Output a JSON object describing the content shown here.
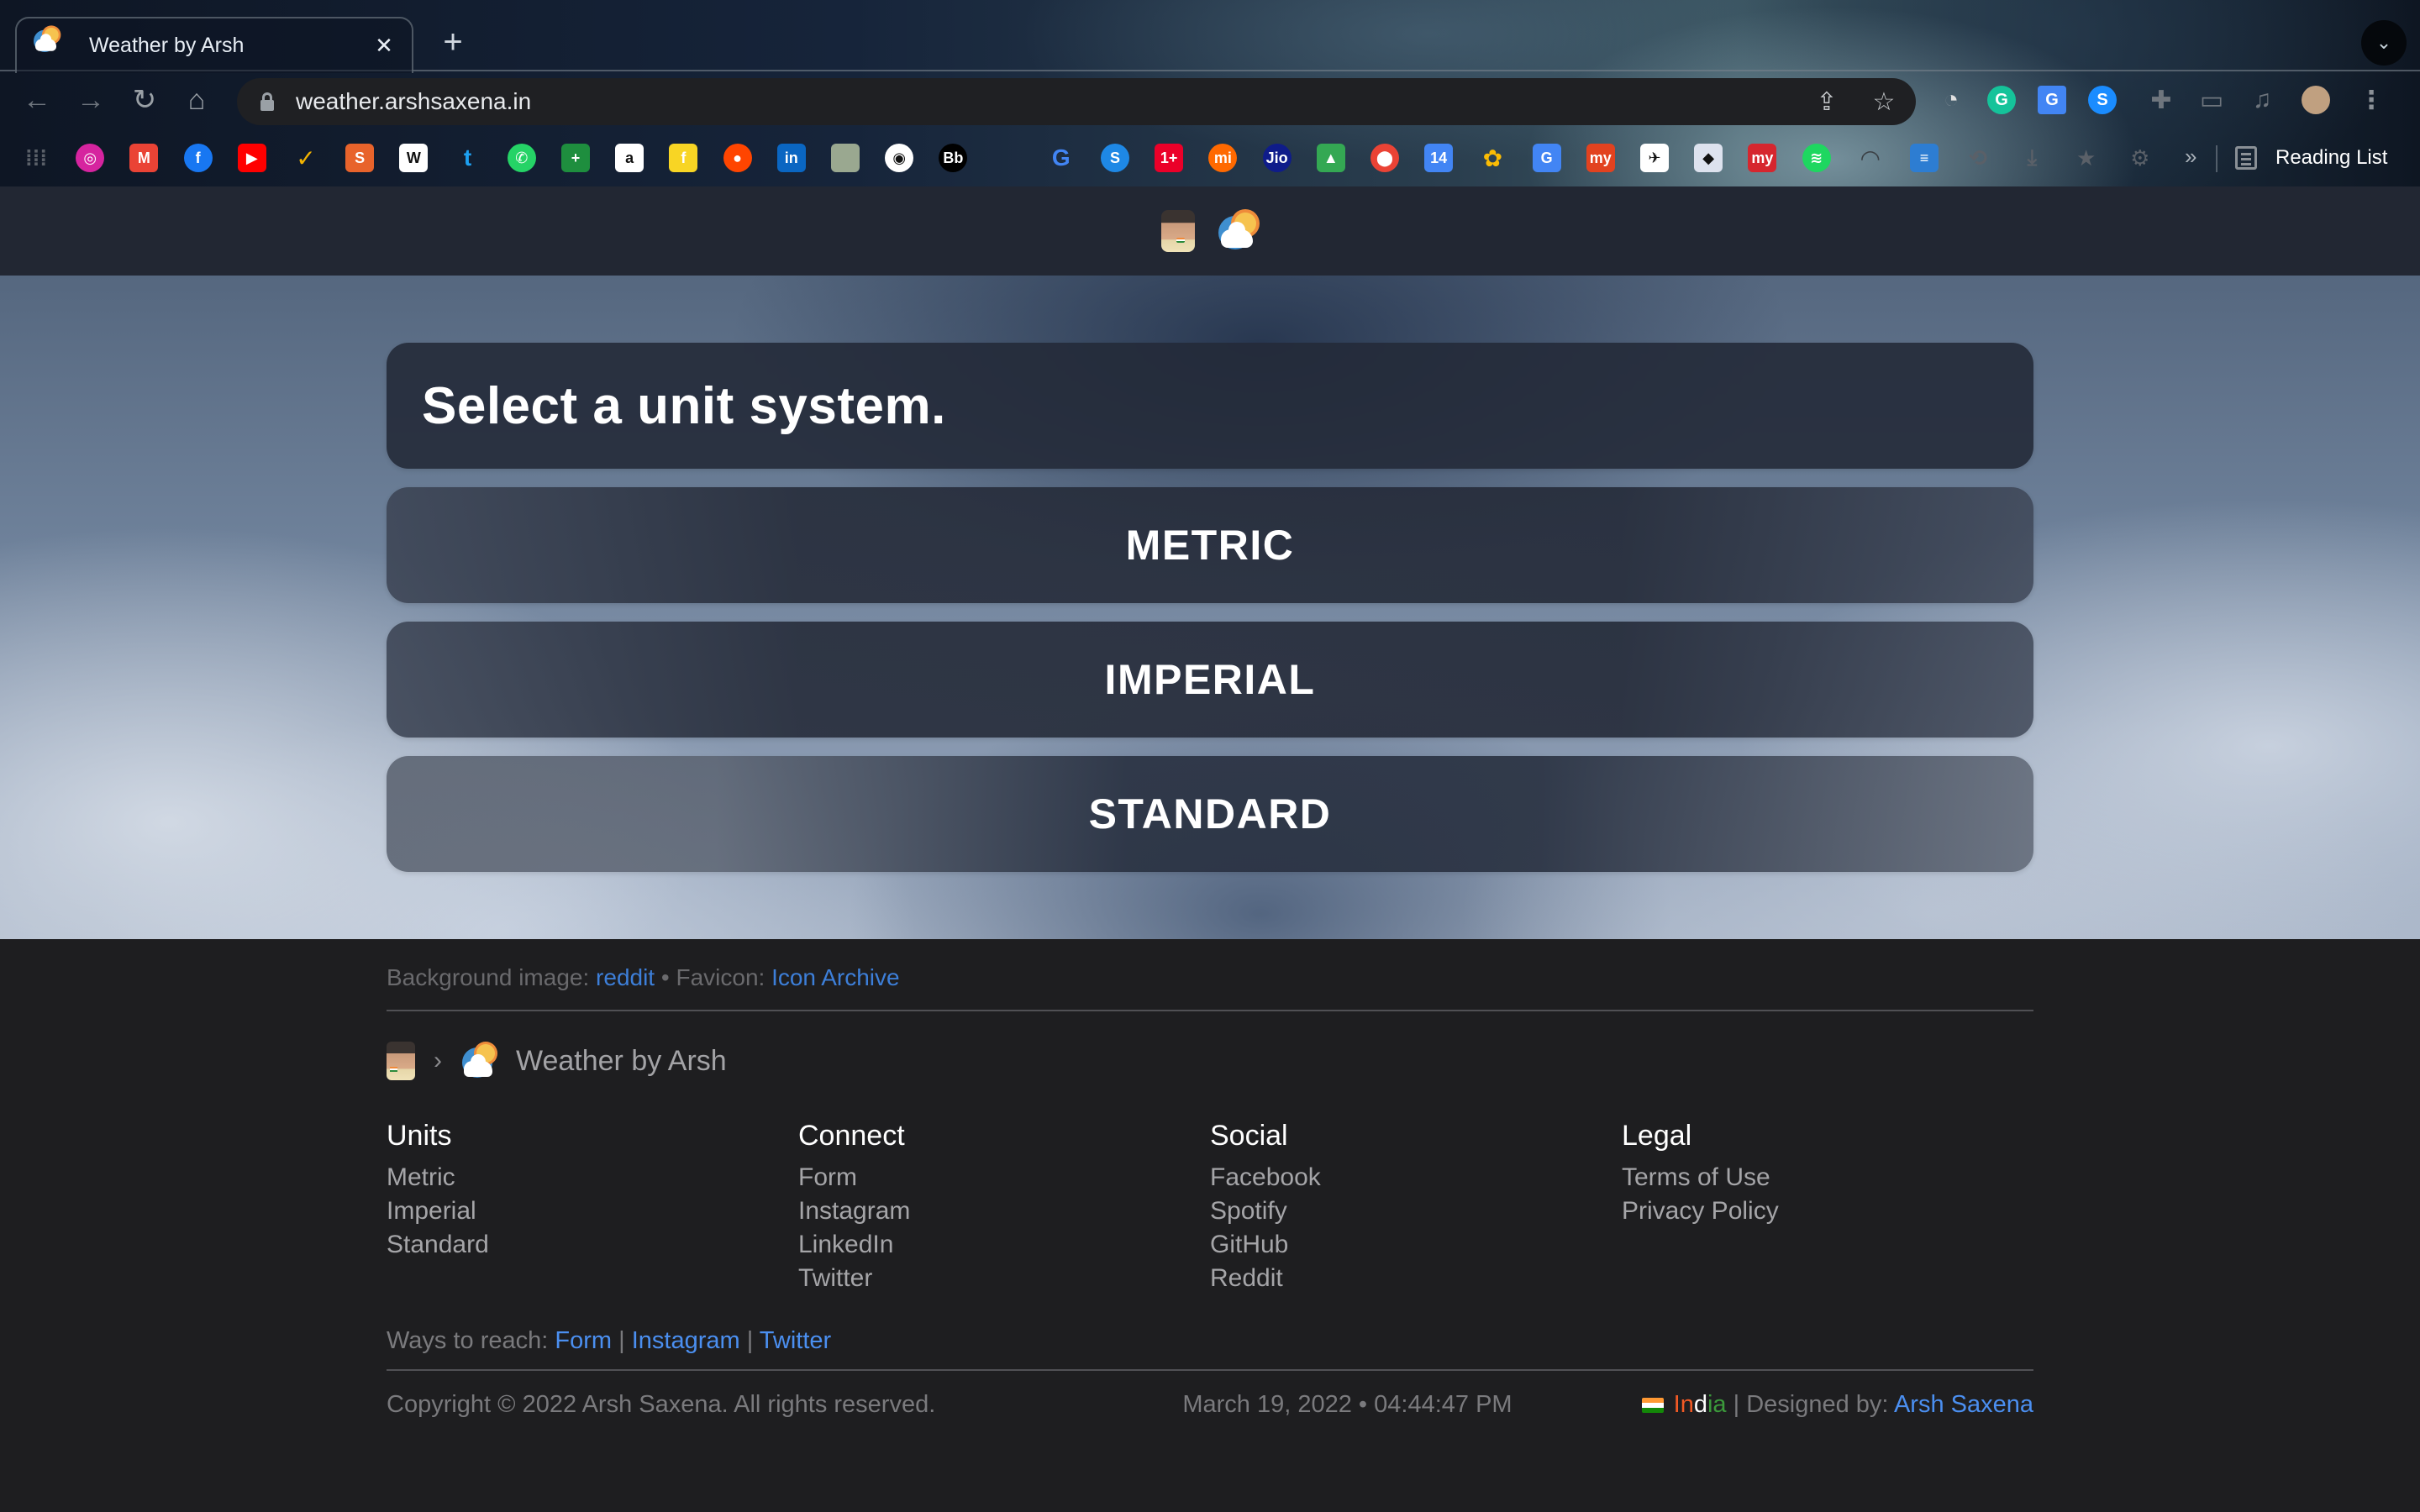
{
  "browser": {
    "tab": {
      "title": "Weather by Arsh",
      "close_glyph": "✕"
    },
    "new_tab_glyph": "+",
    "tab_search_glyph": "⌄",
    "nav": {
      "back": "←",
      "forward": "→",
      "reload": "↻",
      "home": "⌂"
    },
    "url": "weather.arshsaxena.in",
    "omnibox_icons": {
      "share": "⇪",
      "bookmark": "☆"
    },
    "extensions": [
      {
        "name": "speed-dial-extension",
        "glyph": "◔",
        "color": "#e0e0e0"
      },
      {
        "name": "grammarly",
        "glyph": "G",
        "color": "#15c39a"
      },
      {
        "name": "google-translate",
        "glyph": "G",
        "color": "#4285f4"
      },
      {
        "name": "shazam",
        "glyph": "S",
        "color": "#1a8cff"
      },
      {
        "name": "extensions-puzzle",
        "glyph": "✚",
        "color": "#6e757d"
      },
      {
        "name": "cast",
        "glyph": "▭",
        "color": "#6e757d"
      },
      {
        "name": "media-controls",
        "glyph": "♫",
        "color": "#6e757d"
      },
      {
        "name": "profile",
        "glyph": "",
        "color": "#c0a080"
      },
      {
        "name": "menu",
        "glyph": "⋮",
        "color": "#8a9096"
      }
    ],
    "bookmarks": [
      {
        "name": "apps",
        "glyph": "⁞⁞⁞",
        "color": "transparent"
      },
      {
        "name": "instagram",
        "glyph": "◎",
        "color": "#d6249f"
      },
      {
        "name": "gmail",
        "glyph": "M",
        "color": "#ea4335"
      },
      {
        "name": "facebook",
        "glyph": "f",
        "color": "#1877f2"
      },
      {
        "name": "youtube",
        "glyph": "▶",
        "color": "#ff0000"
      },
      {
        "name": "checkmark",
        "glyph": "✓",
        "color": "#f4b400"
      },
      {
        "name": "sbi",
        "glyph": "S",
        "color": "#e8632b"
      },
      {
        "name": "wikipedia",
        "glyph": "W",
        "color": "#ffffff"
      },
      {
        "name": "twitter",
        "glyph": "t",
        "color": "#1da1f2"
      },
      {
        "name": "whatsapp",
        "glyph": "✆",
        "color": "#25d366"
      },
      {
        "name": "google-sheets-plus",
        "glyph": "+",
        "color": "#1e8e3e"
      },
      {
        "name": "amazon",
        "glyph": "a",
        "color": "#ffffff"
      },
      {
        "name": "flipkart",
        "glyph": "f",
        "color": "#f8d524"
      },
      {
        "name": "reddit",
        "glyph": "●",
        "color": "#ff4500"
      },
      {
        "name": "linkedin",
        "glyph": "in",
        "color": "#0a66c2"
      },
      {
        "name": "profile-photo",
        "glyph": "",
        "color": "#9aa890"
      },
      {
        "name": "github",
        "glyph": "◉",
        "color": "#ffffff"
      },
      {
        "name": "blackboard",
        "glyph": "Bb",
        "color": "#000000"
      },
      {
        "name": "apple",
        "glyph": "",
        "color": "#8a8a8a"
      },
      {
        "name": "google",
        "glyph": "G",
        "color": "#4285f4"
      },
      {
        "name": "skype",
        "glyph": "S",
        "color": "#1e88e5"
      },
      {
        "name": "oneplus",
        "glyph": "1+",
        "color": "#eb0029"
      },
      {
        "name": "mi",
        "glyph": "mi",
        "color": "#ff6900"
      },
      {
        "name": "jio",
        "glyph": "Jio",
        "color": "#0f1c8a"
      },
      {
        "name": "google-drive",
        "glyph": "▲",
        "color": "#34a853"
      },
      {
        "name": "google-maps",
        "glyph": "⬤",
        "color": "#ea4335"
      },
      {
        "name": "google-calendar",
        "glyph": "14",
        "color": "#4285f4"
      },
      {
        "name": "google-photos",
        "glyph": "✿",
        "color": "#fbbc04"
      },
      {
        "name": "google-translate",
        "glyph": "G",
        "color": "#4285f4"
      },
      {
        "name": "makemytrip",
        "glyph": "my",
        "color": "#e2421f"
      },
      {
        "name": "airline",
        "glyph": "✈",
        "color": "#ffffff"
      },
      {
        "name": "game-site",
        "glyph": "◆",
        "color": "#dde2ee"
      },
      {
        "name": "myntra-my",
        "glyph": "my",
        "color": "#d6262e"
      },
      {
        "name": "spotify",
        "glyph": "≋",
        "color": "#1ed760"
      },
      {
        "name": "speedtest",
        "glyph": "◠",
        "color": "#3a3f44"
      },
      {
        "name": "scripts",
        "glyph": "≡",
        "color": "#2d7dd2"
      },
      {
        "name": "history",
        "glyph": "⟲",
        "color": "transparent"
      },
      {
        "name": "downloads",
        "glyph": "⤓",
        "color": "transparent"
      },
      {
        "name": "bookmarks-star",
        "glyph": "★",
        "color": "transparent"
      },
      {
        "name": "settings",
        "glyph": "⚙",
        "color": "transparent"
      }
    ],
    "bookmarks_overflow_glyph": "»",
    "reading_list_label": "Reading List"
  },
  "main": {
    "title": "Select a unit system.",
    "unit_buttons": [
      {
        "label": "METRIC"
      },
      {
        "label": "IMPERIAL"
      },
      {
        "label": "STANDARD"
      }
    ]
  },
  "footer": {
    "credits": {
      "bg_prefix": "Background image: ",
      "bg_link": "reddit",
      "separator": " • ",
      "favicon_prefix": "Favicon: ",
      "favicon_link": "Icon Archive"
    },
    "breadcrumb": {
      "separator": "›",
      "title": "Weather by Arsh"
    },
    "columns": [
      {
        "heading": "Units",
        "links": [
          "Metric",
          "Imperial",
          "Standard"
        ]
      },
      {
        "heading": "Connect",
        "links": [
          "Form",
          "Instagram",
          "LinkedIn",
          "Twitter"
        ]
      },
      {
        "heading": "Social",
        "links": [
          "Facebook",
          "Spotify",
          "GitHub",
          "Reddit"
        ]
      },
      {
        "heading": "Legal",
        "links": [
          "Terms of Use",
          "Privacy Policy"
        ]
      }
    ],
    "reach": {
      "prefix": "Ways to reach: ",
      "links": [
        "Form",
        "Instagram",
        "Twitter"
      ],
      "pipe": " | "
    },
    "copyright": "Copyright © 2022 Arsh Saxena. All rights reserved.",
    "datetime": "March 19, 2022 • 04:44:47 PM",
    "country": {
      "part1": "In",
      "part2": "d",
      "part3": "ia"
    },
    "designed_by_prefix": " | Designed by: ",
    "designer": "Arsh Saxena"
  },
  "colors": {
    "link": "#3d7fd9",
    "link_bright": "#4b8ff0",
    "panel": "#242a38",
    "app_header": "#222733",
    "footer_bg": "#1e1e20"
  }
}
